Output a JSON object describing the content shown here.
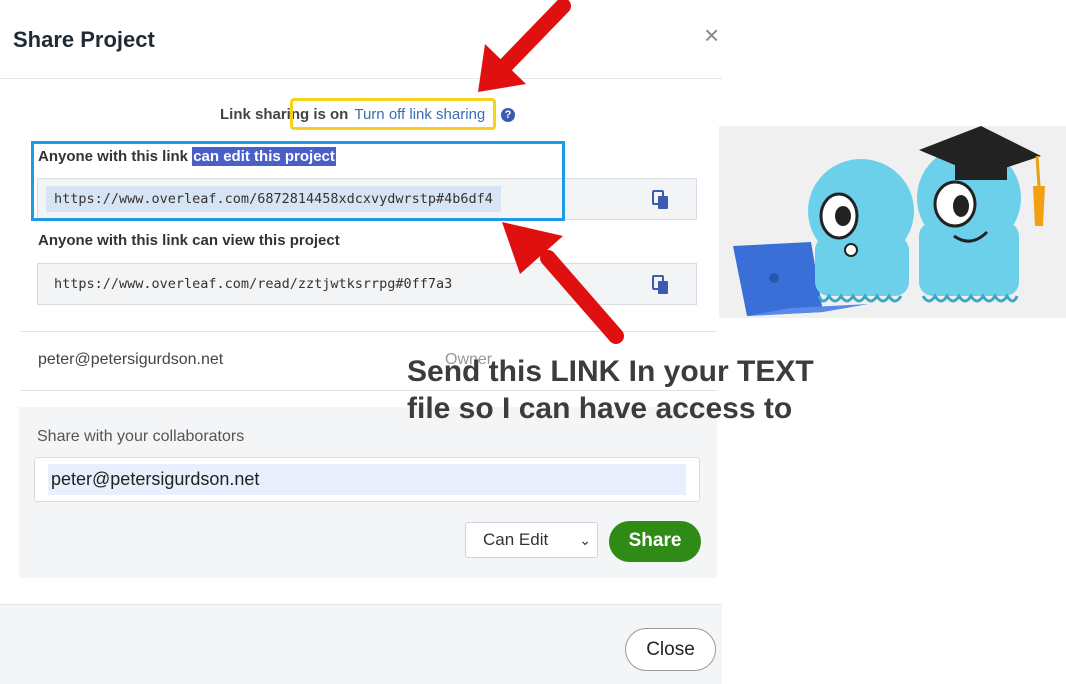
{
  "dialog": {
    "title": "Share Project",
    "close_icon": "×"
  },
  "link_sharing": {
    "status_prefix": "Link sharing is on",
    "toggle_label": "Turn off link sharing",
    "help_icon": "?"
  },
  "edit_link": {
    "label_prefix": "Anyone with this link ",
    "label_highlight": "can edit this project",
    "url": "https://www.overleaf.com/6872814458xdcxvydwrstp#4b6df4"
  },
  "view_link": {
    "label": "Anyone with this link can view this project",
    "url": "https://www.overleaf.com/read/zztjwtksrrpg#0ff7a3"
  },
  "members": [
    {
      "email": "peter@petersigurdson.net",
      "role": "Owner"
    }
  ],
  "share_form": {
    "label": "Share with your collaborators",
    "input_value": "peter@petersigurdson.net",
    "permission": "Can Edit",
    "share_label": "Share"
  },
  "footer": {
    "close_label": "Close"
  },
  "annotation": {
    "line1": "Send this LINK In your TEXT",
    "line2": "file so I can have access to"
  },
  "colors": {
    "arrow": "#e01010",
    "yellow_box": "#f5d21e",
    "blue_box": "#1d9be6",
    "share_button": "#2f8a16",
    "highlight": "#4b5fc9"
  }
}
